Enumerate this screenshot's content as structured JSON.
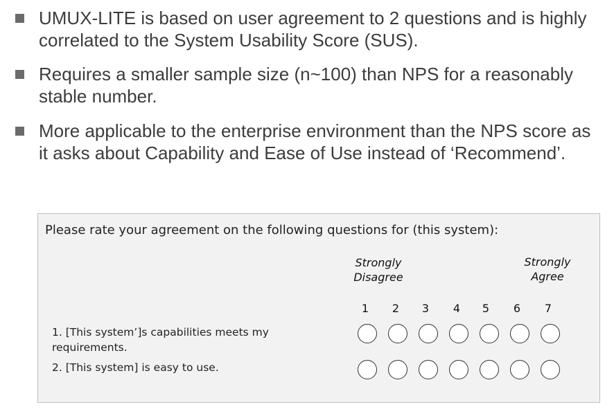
{
  "bullets": [
    {
      "text": "UMUX-LITE is based on user agreement to 2 questions and is highly correlated to the System Usability Score (SUS)."
    },
    {
      "text": "Requires a smaller sample size (n~100) than NPS for a reasonably stable number."
    },
    {
      "text": "More applicable to the enterprise environment than the NPS score as it asks about Capability and Ease of Use instead of ‘Recommend’."
    }
  ],
  "survey": {
    "prompt": "Please rate your agreement on the following questions for (this system):",
    "anchor_left": "Strongly Disagree",
    "anchor_right": "Strongly Agree",
    "scale": [
      "1",
      "2",
      "3",
      "4",
      "5",
      "6",
      "7"
    ],
    "questions": [
      "1. [This system’]s capabilities meets my requirements.",
      "2. [This system] is easy to use."
    ]
  },
  "colors": {
    "bullet_marker": "#6b6b6b",
    "text": "#3c3c3c",
    "panel_background": "#f2f2f2",
    "panel_border": "#bdbdbd"
  }
}
